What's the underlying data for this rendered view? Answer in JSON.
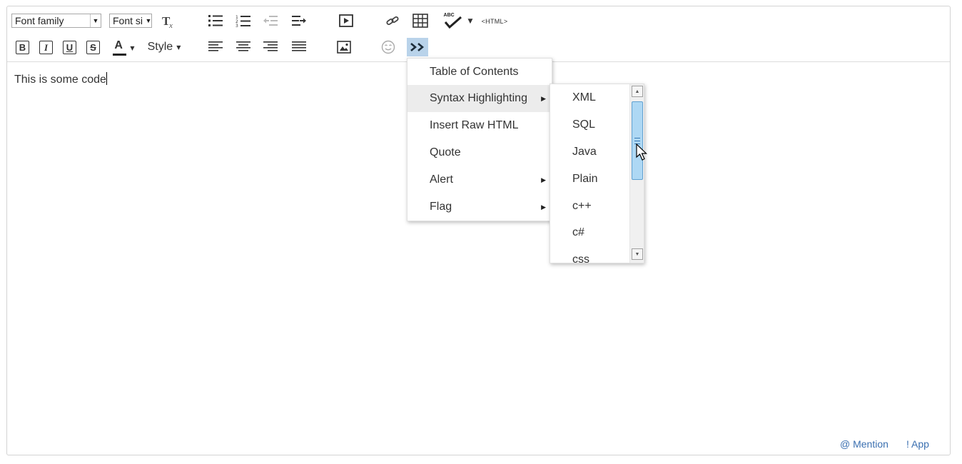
{
  "toolbar": {
    "font_family": "Font family",
    "font_size": "Font si",
    "html_label": "<HTML>",
    "style_label": "Style",
    "spell_label": "ABC",
    "colors": {
      "more_active_bg": "#b9d3ea",
      "text_color_bar": "#222222"
    },
    "icons": {
      "clear_format": "clear-formatting-icon",
      "bullet_list": "bullet-list-icon",
      "numbered_list": "numbered-list-icon",
      "outdent": "outdent-icon",
      "indent": "indent-icon",
      "media": "insert-media-icon",
      "link": "link-icon",
      "table": "table-icon",
      "spellcheck": "spellcheck-icon",
      "bold": "bold-icon",
      "italic": "italic-icon",
      "underline": "underline-icon",
      "strike": "strikethrough-icon",
      "text_color": "text-color-icon",
      "align_left": "align-left-icon",
      "align_center": "align-center-icon",
      "align_right": "align-right-icon",
      "justify": "justify-icon",
      "image": "insert-image-icon",
      "emoticon": "emoticon-icon",
      "more": "more-chevrons-icon"
    }
  },
  "editor": {
    "content": "This is some code"
  },
  "menu": {
    "items": [
      {
        "label": "Table of Contents"
      },
      {
        "label": "Syntax Highlighting"
      },
      {
        "label": "Insert Raw HTML"
      },
      {
        "label": "Quote"
      },
      {
        "label": "Alert"
      },
      {
        "label": "Flag"
      }
    ],
    "active_item": "Syntax Highlighting"
  },
  "submenu": {
    "items": [
      {
        "label": "XML"
      },
      {
        "label": "SQL"
      },
      {
        "label": "Java"
      },
      {
        "label": "Plain"
      },
      {
        "label": "c++"
      },
      {
        "label": "c#"
      },
      {
        "label": "css"
      }
    ]
  },
  "footer": {
    "mention": "@ Mention",
    "app": "! App"
  }
}
